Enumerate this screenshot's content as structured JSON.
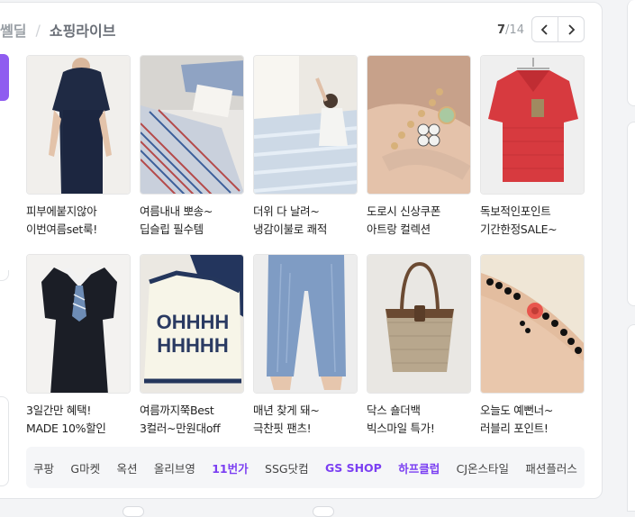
{
  "header": {
    "prev_section": "쎌딜",
    "separator": "/",
    "current_section": "쇼핑라이브"
  },
  "pager": {
    "current": "7",
    "total": "/14",
    "prev_icon": "chevron-left-icon",
    "next_icon": "chevron-right-icon"
  },
  "products": [
    {
      "line1": "피부에붙지않아",
      "line2": "이번여름set룩!"
    },
    {
      "line1": "여름내내 뽀송~",
      "line2": "딥슬립 필수템"
    },
    {
      "line1": "더위 다 날려~",
      "line2": "냉감이불로 쾌적"
    },
    {
      "line1": "도로시 신상쿠폰",
      "line2": "아트랑 컬렉션"
    },
    {
      "line1": "독보적인포인트",
      "line2": "기간한정SALE~"
    },
    {
      "line1": "3일간만 혜택!",
      "line2": "MADE 10%할인"
    },
    {
      "line1": "여름까지쭉Best",
      "line2": "3컬러~만원대off"
    },
    {
      "line1": "매년 찾게 돼~",
      "line2": "극찬핏 팬츠!"
    },
    {
      "line1": "닥스 숄더백",
      "line2": "빅스마일 특가!"
    },
    {
      "line1": "오늘도 예뻔너~",
      "line2": "러블리 포인트!"
    }
  ],
  "shops": [
    {
      "label": "쿠팡",
      "highlight": false
    },
    {
      "label": "G마켓",
      "highlight": false
    },
    {
      "label": "옥션",
      "highlight": false
    },
    {
      "label": "올리브영",
      "highlight": false
    },
    {
      "label": "11번가",
      "highlight": true
    },
    {
      "label": "SSG닷컴",
      "highlight": false
    },
    {
      "label": "GS SHOP",
      "highlight": true
    },
    {
      "label": "하프클럽",
      "highlight": true
    },
    {
      "label": "CJ온스타일",
      "highlight": false
    },
    {
      "label": "패션플러스",
      "highlight": false
    }
  ],
  "colors": {
    "accent": "#7b3ff2",
    "left_tab": "#8f5cf0"
  }
}
